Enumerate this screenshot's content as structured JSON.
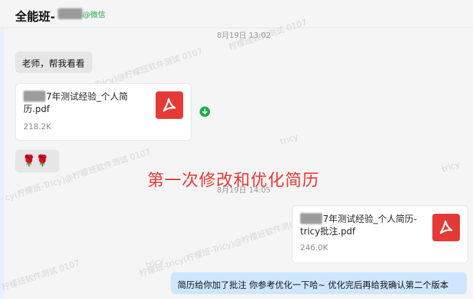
{
  "header": {
    "title": "全能班-",
    "source_tag": "@微信"
  },
  "messages": {
    "time1": "8月19日 13:02",
    "text1": "老师，帮我看看",
    "file1": {
      "name_line1": "7年测试经验_个人简",
      "name_line2": "历.pdf",
      "size": "218.2K"
    },
    "emoji_reply": "🌹🌹",
    "overlay_caption": "第一次修改和优化简历",
    "time2": "8月19日 14:05",
    "file2": {
      "name_line1": "7年测试经验_个人简历-",
      "name_line2": "tricy批注.pdf",
      "size": "246.0K"
    },
    "reply_text": "简历给你加了批注 你参考优化一下哈~ 优化完后再给我确认第二个版本"
  },
  "watermarks": [
    "柠檬班软件测试 0107",
    "柠檬班-tricy(柠檬班-Tricy)@柠檬班软件测试 0107",
    "tricy",
    "cy(柠檬班-Tricy)@柠檬班软件测试 0107",
    "柠檬班-tricy(柠檬班-Tricy)@柠檬班软件测试 0107",
    "tricy",
    "柠檬班软件测试 0107",
    "tricy"
  ],
  "colors": {
    "accent_red": "#e53935",
    "bubble_right": "#cfe6ff",
    "download_green": "#1aad4a"
  },
  "icons": [
    "pdf-icon",
    "download-icon",
    "rose-emoji"
  ]
}
